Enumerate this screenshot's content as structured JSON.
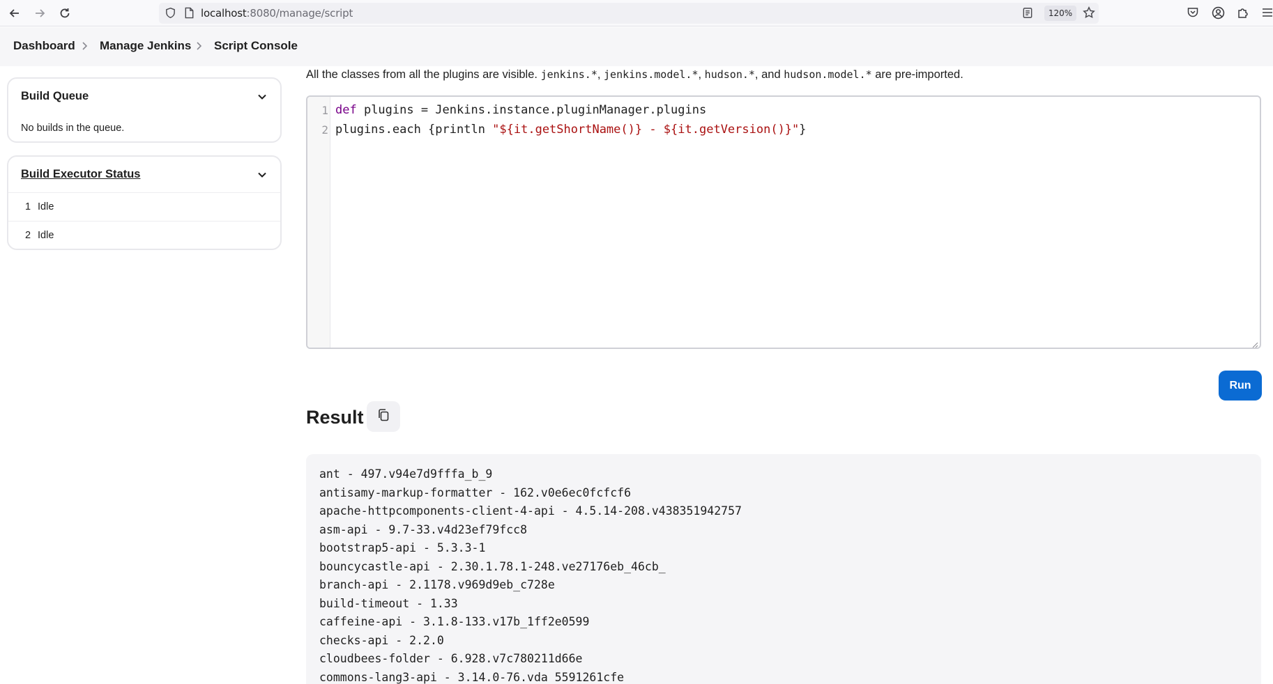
{
  "browser": {
    "url_host": "localhost",
    "url_rest": ":8080/manage/script",
    "zoom": "120%"
  },
  "breadcrumb": {
    "items": [
      "Dashboard",
      "Manage Jenkins",
      "Script Console"
    ]
  },
  "build_queue": {
    "title": "Build Queue",
    "empty_text": "No builds in the queue."
  },
  "executor_status": {
    "title": "Build Executor Status",
    "executors": [
      {
        "number": "1",
        "state": "Idle"
      },
      {
        "number": "2",
        "state": "Idle"
      }
    ]
  },
  "description": {
    "prefix": "All the classes from all the plugins are visible. ",
    "pkg1": "jenkins.*",
    "sep1": ", ",
    "pkg2": "jenkins.model.*",
    "sep2": ", ",
    "pkg3": "hudson.*",
    "sep3": ", and ",
    "pkg4": "hudson.model.*",
    "suffix": " are pre-imported."
  },
  "editor": {
    "line_numbers": [
      "1",
      "2"
    ],
    "line1": {
      "kw": "def",
      "rest": " plugins = Jenkins.instance.pluginManager.plugins"
    },
    "line2": {
      "pre": "plugins.each {println ",
      "str": "\"${it.getShortName()} - ${it.getVersion()}\"",
      "post": "}"
    }
  },
  "run_label": "Run",
  "result": {
    "title": "Result",
    "lines": [
      "ant - 497.v94e7d9fffa_b_9",
      "antisamy-markup-formatter - 162.v0e6ec0fcfcf6",
      "apache-httpcomponents-client-4-api - 4.5.14-208.v438351942757",
      "asm-api - 9.7-33.v4d23ef79fcc8",
      "bootstrap5-api - 5.3.3-1",
      "bouncycastle-api - 2.30.1.78.1-248.ve27176eb_46cb_",
      "branch-api - 2.1178.v969d9eb_c728e",
      "build-timeout - 1.33",
      "caffeine-api - 3.1.8-133.v17b_1ff2e0599",
      "checks-api - 2.2.0",
      "cloudbees-folder - 6.928.v7c780211d66e",
      "commons-lang3-api - 3.14.0-76.vda 5591261cfe"
    ]
  }
}
